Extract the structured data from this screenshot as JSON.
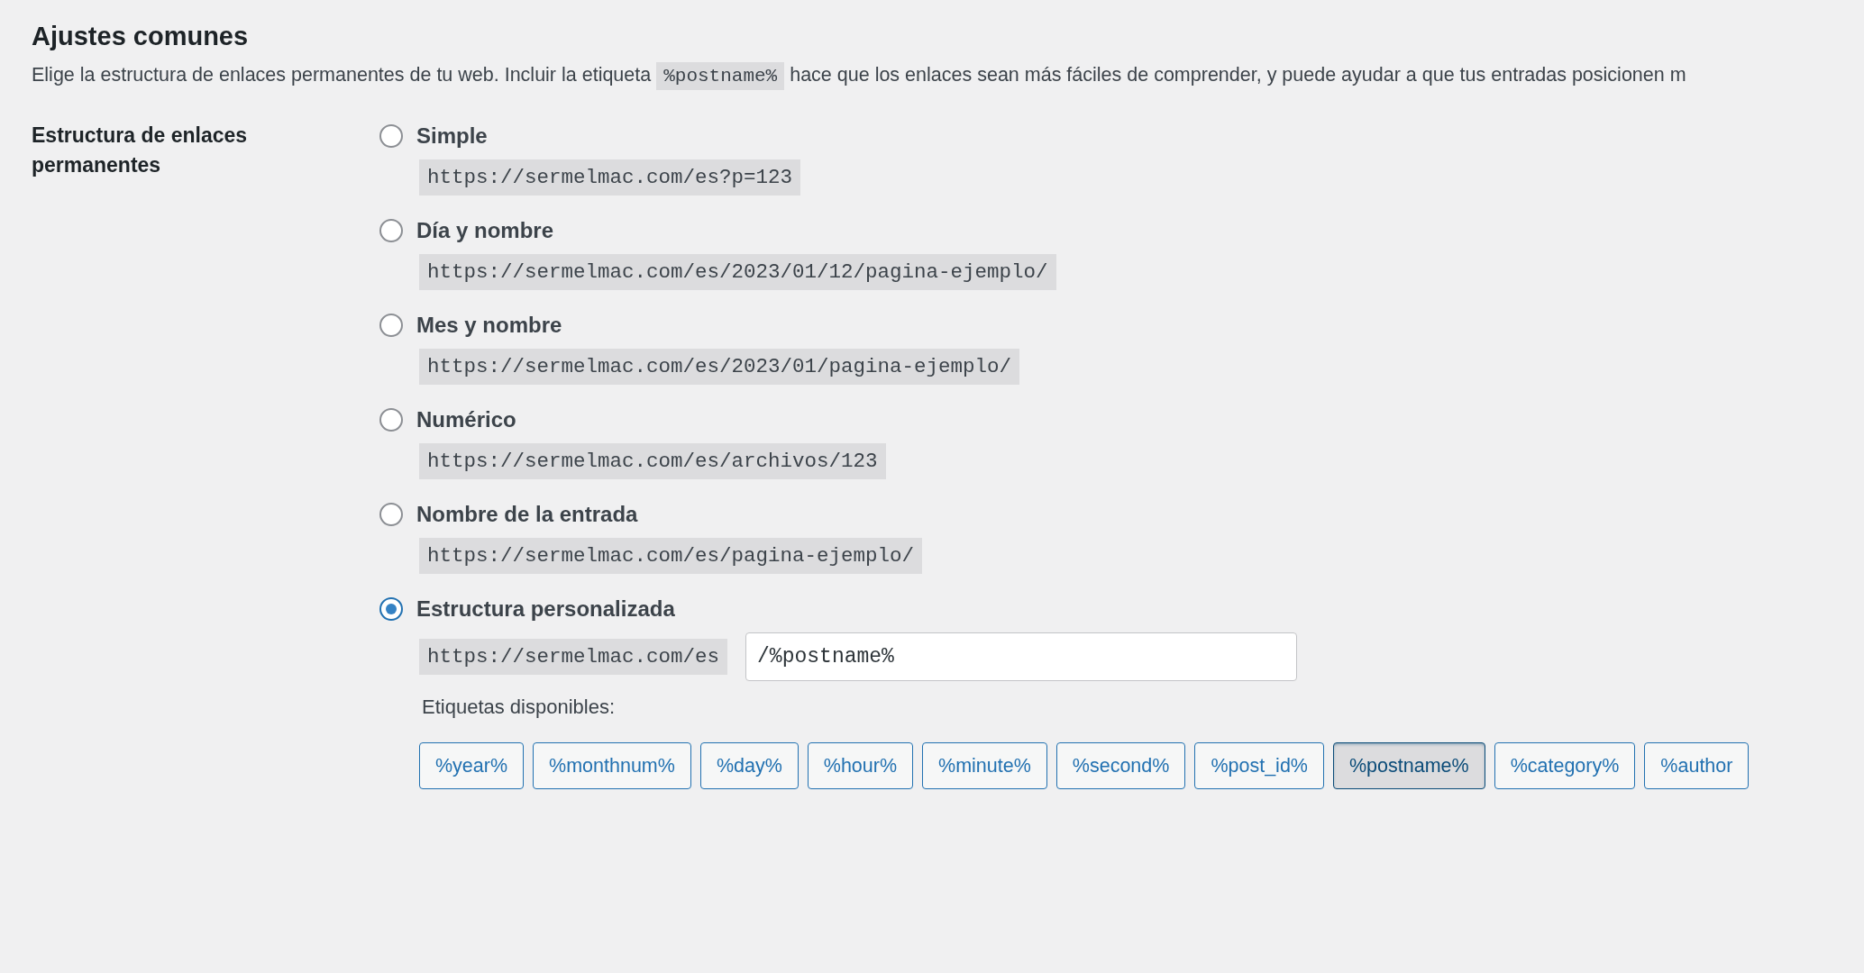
{
  "section": {
    "title": "Ajustes comunes",
    "intro_before": "Elige la estructura de enlaces permanentes de tu web. Incluir la etiqueta",
    "intro_code": "%postname%",
    "intro_after": "hace que los enlaces sean más fáciles de comprender, y puede ayudar a que tus entradas posicionen m"
  },
  "field_label": "Estructura de enlaces permanentes",
  "options": [
    {
      "label": "Simple",
      "selected": false,
      "example": "https://sermelmac.com/es?p=123"
    },
    {
      "label": "Día y nombre",
      "selected": false,
      "example": "https://sermelmac.com/es/2023/01/12/pagina-ejemplo/"
    },
    {
      "label": "Mes y nombre",
      "selected": false,
      "example": "https://sermelmac.com/es/2023/01/pagina-ejemplo/"
    },
    {
      "label": "Numérico",
      "selected": false,
      "example": "https://sermelmac.com/es/archivos/123"
    },
    {
      "label": "Nombre de la entrada",
      "selected": false,
      "example": "https://sermelmac.com/es/pagina-ejemplo/"
    },
    {
      "label": "Estructura personalizada",
      "selected": true,
      "prefix": "https://sermelmac.com/es",
      "value": "/%postname%"
    }
  ],
  "tags_label": "Etiquetas disponibles:",
  "tags": [
    {
      "label": "%year%",
      "selected": false
    },
    {
      "label": "%monthnum%",
      "selected": false
    },
    {
      "label": "%day%",
      "selected": false
    },
    {
      "label": "%hour%",
      "selected": false
    },
    {
      "label": "%minute%",
      "selected": false
    },
    {
      "label": "%second%",
      "selected": false
    },
    {
      "label": "%post_id%",
      "selected": false
    },
    {
      "label": "%postname%",
      "selected": true
    },
    {
      "label": "%category%",
      "selected": false
    },
    {
      "label": "%author",
      "selected": false
    }
  ]
}
